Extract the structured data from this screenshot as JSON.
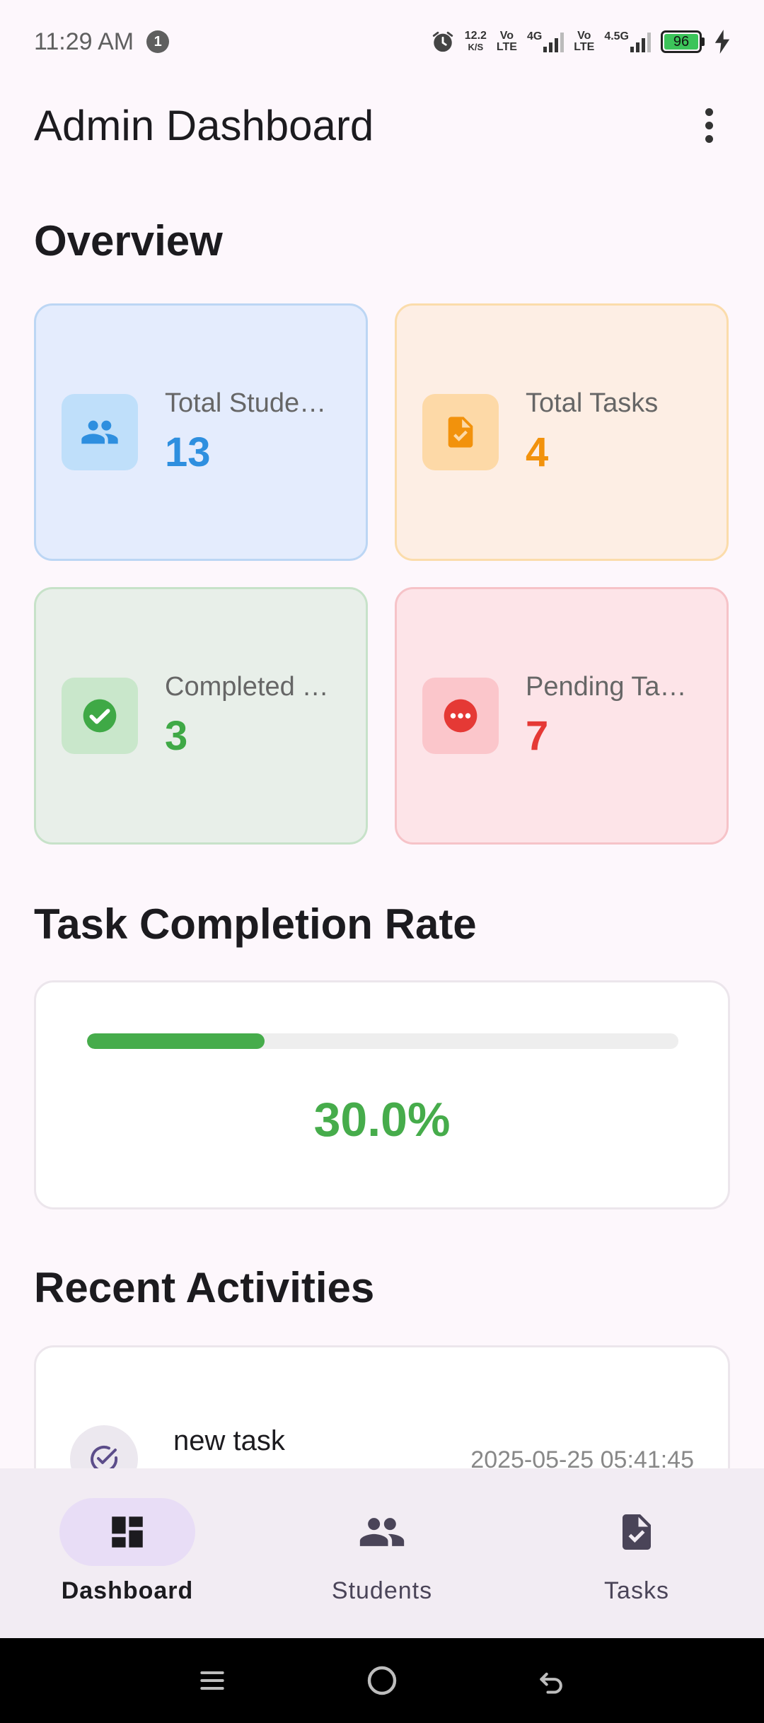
{
  "status_bar": {
    "time": "11:29 AM",
    "notification_count": "1",
    "net_speed_value": "12.2",
    "net_speed_unit": "K/S",
    "sim1_vo": "Vo",
    "sim1_lte": "LTE",
    "sim1_net": "4G",
    "sim2_vo": "Vo",
    "sim2_lte": "LTE",
    "sim2_net": "4.5G",
    "battery_level": "96"
  },
  "app_bar": {
    "title": "Admin Dashboard",
    "menu_icon": "more-vert-icon"
  },
  "overview": {
    "title": "Overview",
    "cards": [
      {
        "label": "Total Students",
        "value": "13",
        "icon": "people-icon",
        "color": "#2e8fdf"
      },
      {
        "label": "Total Tasks",
        "value": "4",
        "icon": "task-document-icon",
        "color": "#f2920c"
      },
      {
        "label": "Completed Tasks",
        "value": "3",
        "icon": "check-circle-icon",
        "color": "#3fa946"
      },
      {
        "label": "Pending Tasks",
        "value": "7",
        "icon": "pending-icon",
        "color": "#e53935"
      }
    ]
  },
  "completion": {
    "title": "Task Completion Rate",
    "rate_text": "30.0%",
    "rate_fraction": 0.3,
    "color": "#46ac4b"
  },
  "recent": {
    "title": "Recent Activities",
    "items": [
      {
        "title": "new task",
        "timestamp": "2025-05-25 05:41:45",
        "icon": "task-check-icon"
      }
    ]
  },
  "bottom_nav": {
    "items": [
      {
        "label": "Dashboard",
        "icon": "dashboard-icon",
        "active": true
      },
      {
        "label": "Students",
        "icon": "people-icon",
        "active": false
      },
      {
        "label": "Tasks",
        "icon": "task-icon",
        "active": false
      }
    ]
  },
  "system_nav": {
    "menu": "menu-icon",
    "home": "home-icon",
    "back": "back-icon"
  }
}
